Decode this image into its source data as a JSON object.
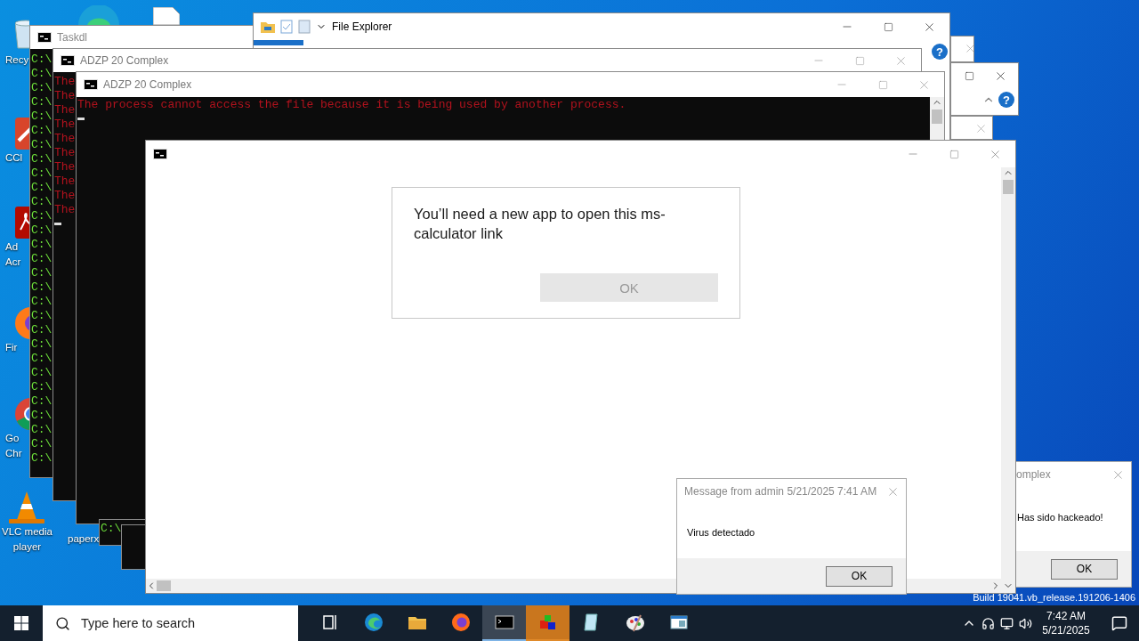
{
  "desktop_icons": [
    {
      "kind": "recycle",
      "lines": [
        "Recy"
      ]
    },
    {
      "kind": "edge"
    },
    {
      "kind": "file"
    },
    {
      "kind": "cleaner",
      "lines": [
        "CCl"
      ]
    },
    {
      "kind": "acrobat",
      "lines": [
        "Ad",
        "Acr"
      ]
    },
    {
      "kind": "firefox",
      "lines": [
        "Fir"
      ]
    },
    {
      "kind": "chrome",
      "lines": [
        "Go",
        "Chr"
      ]
    },
    {
      "kind": "vlc",
      "lines": [
        "VLC media",
        "player"
      ]
    },
    {
      "kind": "hidden",
      "lines": [
        "paperx"
      ]
    }
  ],
  "back_windows": [
    {
      "kind": "close-only"
    },
    {
      "kind": "full",
      "help": "?"
    },
    {
      "kind": "close-only"
    }
  ],
  "file_explorer": {
    "title": "File Explorer",
    "help": "?"
  },
  "taskdl_window": {
    "title": "Taskdl",
    "lines": [
      "C:\\",
      "C:\\",
      "C:\\",
      "C:\\",
      "C:\\",
      "C:\\",
      "C:\\",
      "C:\\",
      "C:\\",
      "C:\\",
      "C:\\",
      "C:\\",
      "C:\\",
      "C:\\",
      "C:\\",
      "C:\\",
      "C:\\",
      "C:\\",
      "C:\\",
      "C:\\",
      "C:\\",
      "C:\\",
      "C:\\",
      "C:\\",
      "C:\\",
      "C:\\",
      "C:\\",
      "C:\\",
      "C:\\"
    ]
  },
  "complex_windows": [
    {
      "title": "ADZP 20 Complex",
      "lines": [
        "The",
        "The",
        "The",
        "The",
        "The",
        "The",
        "The",
        "The",
        "The",
        "The"
      ]
    },
    {
      "title": "ADZP 20 Complex",
      "lines": [
        "The process cannot access the file because it is being used by another process."
      ]
    }
  ],
  "small_console": {
    "lines": [
      "C:\\"
    ]
  },
  "app_prompt": {
    "message": "You’ll need a new app to open this ms-calculator link",
    "button": "OK"
  },
  "message_box": {
    "title": "Message from admin 5/21/2025 7:41 AM",
    "message": "Virus detectado",
    "button": "OK"
  },
  "hacked_box": {
    "title": "omplex",
    "message": "Has sido hackeado!",
    "button": "OK"
  },
  "build_text": "Build 19041.vb_release.191206-1406",
  "taskbar": {
    "search_placeholder": "Type here to search",
    "apps": [
      {
        "kind": "task-view",
        "active": false,
        "flashing": false
      },
      {
        "kind": "edge",
        "active": false,
        "flashing": false
      },
      {
        "kind": "folder",
        "active": false,
        "flashing": false
      },
      {
        "kind": "firefox",
        "active": false,
        "flashing": false
      },
      {
        "kind": "console",
        "active": true,
        "flashing": false
      },
      {
        "kind": "blocks",
        "active": false,
        "flashing": true
      },
      {
        "kind": "notepad",
        "active": false,
        "flashing": false
      },
      {
        "kind": "paint",
        "active": false,
        "flashing": false
      },
      {
        "kind": "window",
        "active": false,
        "flashing": false
      }
    ],
    "time": "7:42 AM",
    "date": "5/21/2025"
  }
}
